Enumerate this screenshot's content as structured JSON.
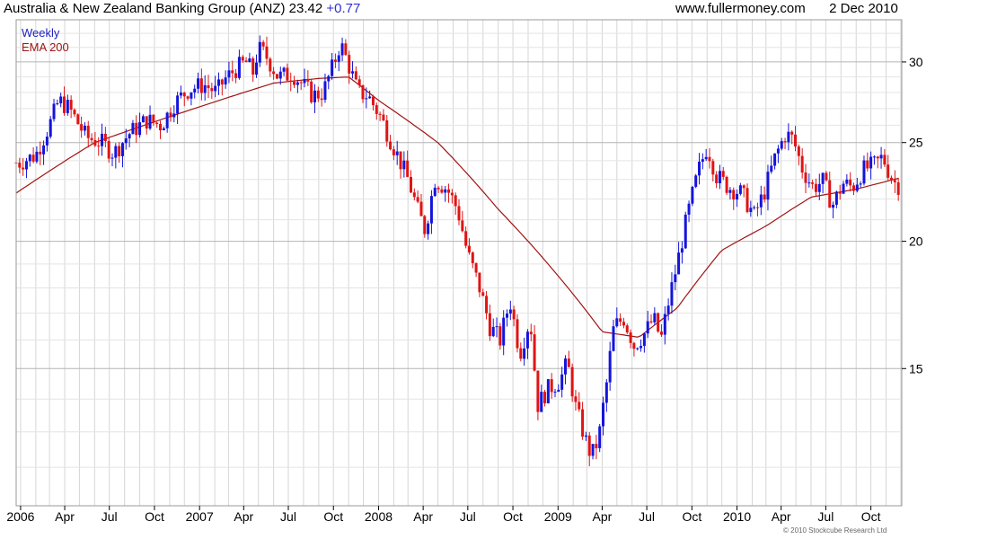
{
  "header": {
    "company": "Australia & New Zealand Banking Group (ANZ)",
    "last_price": "23.42",
    "change": "+0.77",
    "source": "www.fullermoney.com",
    "date": "2 Dec 2010"
  },
  "legend": {
    "weekly": "Weekly",
    "ema": "EMA 200"
  },
  "footer": {
    "copyright": "© 2010 Stockcube Research Ltd"
  },
  "colors": {
    "up": "#1414dc",
    "down": "#e01414",
    "ema": "#a01414",
    "grid": "#d6d6d6",
    "axis": "#000000"
  },
  "chart_data": {
    "type": "candlestick",
    "series_price": "Weekly",
    "series_ema": "EMA 200",
    "y_scale": "log",
    "ylim": [
      11,
      33
    ],
    "y_ticks": [
      15,
      20,
      25,
      30
    ],
    "y_axis_side": "right",
    "x_range": [
      "2005-12-23",
      "2010-12-03"
    ],
    "x_ticks": [
      {
        "date": "2006-01-01",
        "label": "2006"
      },
      {
        "date": "2006-04-01",
        "label": "Apr"
      },
      {
        "date": "2006-07-01",
        "label": "Jul"
      },
      {
        "date": "2006-10-01",
        "label": "Oct"
      },
      {
        "date": "2007-01-01",
        "label": "2007"
      },
      {
        "date": "2007-04-01",
        "label": "Apr"
      },
      {
        "date": "2007-07-01",
        "label": "Jul"
      },
      {
        "date": "2007-10-01",
        "label": "Oct"
      },
      {
        "date": "2008-01-01",
        "label": "2008"
      },
      {
        "date": "2008-04-01",
        "label": "Apr"
      },
      {
        "date": "2008-07-01",
        "label": "Jul"
      },
      {
        "date": "2008-10-01",
        "label": "Oct"
      },
      {
        "date": "2009-01-01",
        "label": "2009"
      },
      {
        "date": "2009-04-01",
        "label": "Apr"
      },
      {
        "date": "2009-07-01",
        "label": "Jul"
      },
      {
        "date": "2009-10-01",
        "label": "Oct"
      },
      {
        "date": "2010-01-01",
        "label": "2010"
      },
      {
        "date": "2010-04-01",
        "label": "Apr"
      },
      {
        "date": "2010-07-01",
        "label": "Jul"
      },
      {
        "date": "2010-10-01",
        "label": "Oct"
      }
    ],
    "grid": true,
    "close_anchors": [
      [
        "2005-12-30",
        23.9
      ],
      [
        "2006-02-01",
        24.3
      ],
      [
        "2006-03-01",
        26.0
      ],
      [
        "2006-03-20",
        27.5
      ],
      [
        "2006-04-10",
        27.0
      ],
      [
        "2006-05-15",
        25.3
      ],
      [
        "2006-06-15",
        25.0
      ],
      [
        "2006-07-10",
        24.4
      ],
      [
        "2006-08-10",
        25.5
      ],
      [
        "2006-09-15",
        26.3
      ],
      [
        "2006-10-15",
        26.0
      ],
      [
        "2006-11-10",
        27.3
      ],
      [
        "2006-12-10",
        28.2
      ],
      [
        "2007-01-10",
        28.5
      ],
      [
        "2007-02-05",
        28.0
      ],
      [
        "2007-02-20",
        28.8
      ],
      [
        "2007-03-15",
        29.5
      ],
      [
        "2007-04-05",
        30.0
      ],
      [
        "2007-04-20",
        29.3
      ],
      [
        "2007-05-01",
        30.9
      ],
      [
        "2007-05-15",
        30.5
      ],
      [
        "2007-06-10",
        29.0
      ],
      [
        "2007-07-10",
        29.2
      ],
      [
        "2007-08-05",
        28.3
      ],
      [
        "2007-08-20",
        27.8
      ],
      [
        "2007-09-10",
        28.0
      ],
      [
        "2007-10-01",
        29.8
      ],
      [
        "2007-10-15",
        31.3
      ],
      [
        "2007-11-01",
        29.8
      ],
      [
        "2007-11-20",
        28.0
      ],
      [
        "2007-12-10",
        27.8
      ],
      [
        "2008-01-05",
        26.5
      ],
      [
        "2008-01-20",
        25.5
      ],
      [
        "2008-02-05",
        24.5
      ],
      [
        "2008-03-01",
        23.0
      ],
      [
        "2008-03-20",
        21.5
      ],
      [
        "2008-04-05",
        20.5
      ],
      [
        "2008-04-25",
        23.0
      ],
      [
        "2008-05-20",
        22.5
      ],
      [
        "2008-06-10",
        21.5
      ],
      [
        "2008-06-30",
        19.5
      ],
      [
        "2008-07-25",
        18.0
      ],
      [
        "2008-08-15",
        16.5
      ],
      [
        "2008-09-05",
        16.0
      ],
      [
        "2008-09-25",
        17.5
      ],
      [
        "2008-10-15",
        15.5
      ],
      [
        "2008-11-05",
        16.8
      ],
      [
        "2008-11-20",
        13.8
      ],
      [
        "2008-12-10",
        14.3
      ],
      [
        "2009-01-05",
        14.6
      ],
      [
        "2009-01-20",
        15.2
      ],
      [
        "2009-02-05",
        13.8
      ],
      [
        "2009-02-25",
        12.8
      ],
      [
        "2009-03-10",
        12.3
      ],
      [
        "2009-03-25",
        12.8
      ],
      [
        "2009-04-10",
        14.5
      ],
      [
        "2009-04-25",
        16.5
      ],
      [
        "2009-05-15",
        16.8
      ],
      [
        "2009-06-05",
        15.8
      ],
      [
        "2009-06-25",
        16.2
      ],
      [
        "2009-07-15",
        16.8
      ],
      [
        "2009-07-30",
        16.0
      ],
      [
        "2009-08-15",
        17.5
      ],
      [
        "2009-09-01",
        19.0
      ],
      [
        "2009-09-20",
        21.0
      ],
      [
        "2009-10-15",
        23.5
      ],
      [
        "2009-11-01",
        24.8
      ],
      [
        "2009-11-20",
        23.2
      ],
      [
        "2009-12-15",
        22.6
      ],
      [
        "2010-01-10",
        22.3
      ],
      [
        "2010-02-05",
        21.2
      ],
      [
        "2010-02-25",
        22.3
      ],
      [
        "2010-03-20",
        24.2
      ],
      [
        "2010-04-10",
        25.5
      ],
      [
        "2010-04-25",
        25.2
      ],
      [
        "2010-05-15",
        23.5
      ],
      [
        "2010-06-05",
        22.6
      ],
      [
        "2010-06-25",
        22.9
      ],
      [
        "2010-07-15",
        21.7
      ],
      [
        "2010-08-05",
        22.8
      ],
      [
        "2010-08-25",
        22.6
      ],
      [
        "2010-09-15",
        23.5
      ],
      [
        "2010-10-10",
        23.8
      ],
      [
        "2010-10-25",
        24.2
      ],
      [
        "2010-11-10",
        23.2
      ],
      [
        "2010-11-25",
        22.6
      ],
      [
        "2010-12-02",
        23.42
      ]
    ],
    "ema_anchors": [
      [
        "2005-12-23",
        22.3
      ],
      [
        "2006-06-01",
        25.0
      ],
      [
        "2006-12-01",
        26.8
      ],
      [
        "2007-06-01",
        28.6
      ],
      [
        "2007-09-01",
        28.9
      ],
      [
        "2007-11-01",
        29.0
      ],
      [
        "2008-01-01",
        27.5
      ],
      [
        "2008-05-01",
        25.0
      ],
      [
        "2008-09-01",
        21.5
      ],
      [
        "2009-01-01",
        18.5
      ],
      [
        "2009-04-01",
        16.3
      ],
      [
        "2009-06-15",
        16.1
      ],
      [
        "2009-09-01",
        17.2
      ],
      [
        "2009-12-01",
        19.6
      ],
      [
        "2010-03-01",
        20.7
      ],
      [
        "2010-06-01",
        22.1
      ],
      [
        "2010-09-01",
        22.5
      ],
      [
        "2010-12-02",
        23.1
      ]
    ]
  }
}
